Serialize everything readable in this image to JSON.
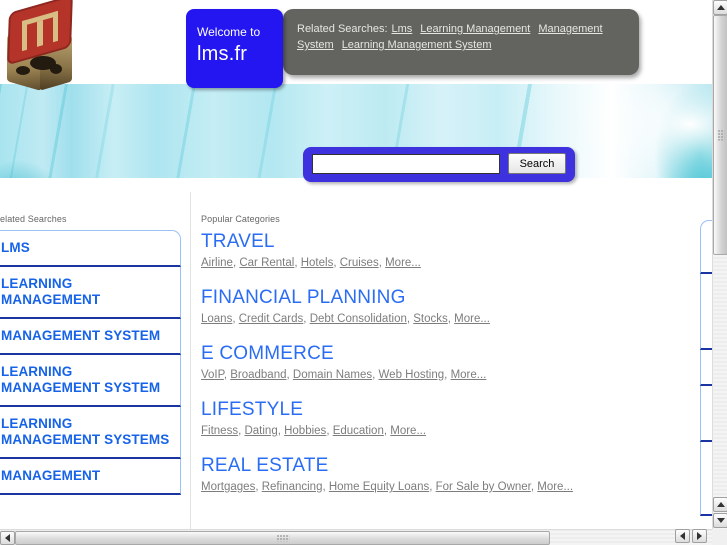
{
  "site": {
    "logo_alt": "lms.fr cube logo",
    "welcome_line1": "Welcome to",
    "welcome_line2": "lms.fr"
  },
  "related_bar": {
    "label": "Related Searches:",
    "links": [
      "Lms",
      "Learning Management",
      "Management System",
      "Learning Management System"
    ]
  },
  "search": {
    "value": "",
    "placeholder": "",
    "button_label": "Search"
  },
  "left_column": {
    "heading": "elated Searches",
    "items": [
      "LMS",
      "LEARNING MANAGEMENT",
      "MANAGEMENT SYSTEM",
      "LEARNING MANAGEMENT SYSTEM",
      "LEARNING MANAGEMENT SYSTEMS",
      "MANAGEMENT"
    ]
  },
  "right_column": {
    "items": [
      "",
      "",
      "",
      "",
      ""
    ]
  },
  "center_column": {
    "heading": "Popular Categories",
    "categories": [
      {
        "title": "TRAVEL",
        "links": [
          "Airline",
          "Car Rental",
          "Hotels",
          "Cruises",
          "More..."
        ]
      },
      {
        "title": "FINANCIAL PLANNING",
        "links": [
          "Loans",
          "Credit Cards",
          "Debt Consolidation",
          "Stocks",
          "More..."
        ]
      },
      {
        "title": "E COMMERCE",
        "links": [
          "VoIP",
          "Broadband",
          "Domain Names",
          "Web Hosting",
          "More..."
        ]
      },
      {
        "title": "LIFESTYLE",
        "links": [
          "Fitness",
          "Dating",
          "Hobbies",
          "Education",
          "More..."
        ]
      },
      {
        "title": "REAL ESTATE",
        "links": [
          "Mortgages",
          "Refinancing",
          "Home Equity Loans",
          "For Sale by Owner",
          "More..."
        ]
      }
    ]
  },
  "colors": {
    "welcome_panel": "#2316f0",
    "related_panel": "#636360",
    "search_panel": "#3d32dd",
    "link_blue": "#1763e8",
    "category_blue": "#2a6df4",
    "sublink_grey": "#7d7d7d",
    "banner_cyan": "#a8e4ef",
    "separator_navy": "#1b35a0"
  }
}
